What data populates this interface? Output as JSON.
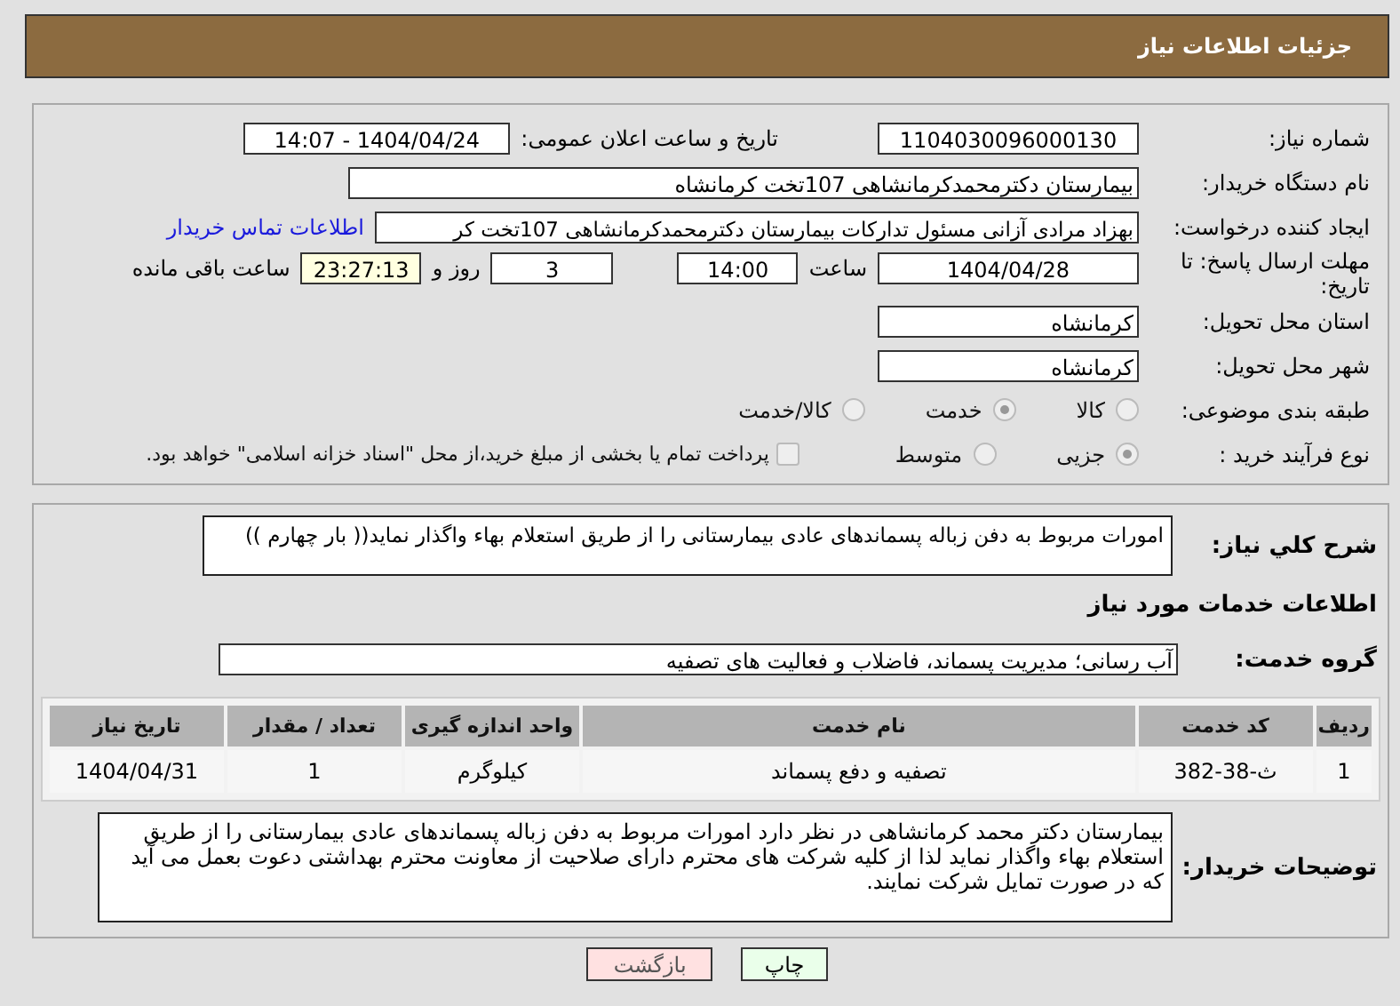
{
  "header": {
    "title": "جزئیات اطلاعات نیاز"
  },
  "need_number": {
    "label": "شماره نیاز:",
    "value": "1104030096000130"
  },
  "announce_date": {
    "label": "تاریخ و ساعت اعلان عمومی:",
    "value": "1404/04/24 - 14:07"
  },
  "buyer_org": {
    "label": "نام دستگاه خریدار:",
    "value": "بیمارستان دکترمحمدکرمانشاهی 107تخت کرمانشاه"
  },
  "requester": {
    "label": "ایجاد کننده درخواست:",
    "value": "بهزاد مرادی آزانی مسئول تدارکات بیمارستان دکترمحمدکرمانشاهی 107تخت کر",
    "link": "اطلاعات تماس خریدار"
  },
  "deadline": {
    "label": "مهلت ارسال پاسخ: تا تاریخ:",
    "date": "1404/04/28",
    "time_label": "ساعت",
    "time": "14:00",
    "days": "3",
    "days_label": "روز و",
    "remaining": "23:27:13",
    "remaining_label": "ساعت باقی مانده"
  },
  "province": {
    "label": "استان محل تحویل:",
    "value": "کرمانشاه"
  },
  "city": {
    "label": "شهر محل تحویل:",
    "value": "کرمانشاه"
  },
  "category": {
    "label": "طبقه بندی موضوعی:",
    "options": [
      {
        "label": "کالا",
        "selected": false
      },
      {
        "label": "خدمت",
        "selected": true
      },
      {
        "label": "کالا/خدمت",
        "selected": false
      }
    ]
  },
  "purchase_process": {
    "label": "نوع فرآیند خرید :",
    "options": [
      {
        "label": "جزیی",
        "selected": true
      },
      {
        "label": "متوسط",
        "selected": false
      }
    ],
    "payment": {
      "checked": false,
      "text": "پرداخت تمام یا بخشی از مبلغ خرید،از محل \"اسناد خزانه اسلامی\" خواهد بود."
    }
  },
  "description": {
    "label": "شرح کلي نياز:",
    "value": "امورات مربوط به دفن زباله پسماندهای عادی بیمارستانی را از طریق استعلام بهاء واگذار نماید(( بار چهارم ))"
  },
  "services_title": "اطلاعات خدمات مورد نیاز",
  "service_group": {
    "label": "گروه خدمت:",
    "value": "آب رسانی؛ مدیریت پسماند، فاضلاب و فعالیت های تصفیه"
  },
  "table": {
    "columns": [
      "ردیف",
      "کد خدمت",
      "نام خدمت",
      "واحد اندازه گیری",
      "تعداد / مقدار",
      "تاریخ نیاز"
    ],
    "rows": [
      [
        "1",
        "ث-38-382",
        "تصفیه و دفع پسماند",
        "کیلوگرم",
        "1",
        "1404/04/31"
      ]
    ]
  },
  "buyer_notes": {
    "label": "توضیحات خریدار:",
    "value": "بیمارستان دکتر محمد کرمانشاهی در نظر دارد امورات مربوط به دفن زباله پسماندهای عادی بیمارستانی را از طریق استعلام بهاء واگذار نماید لذا از کلیه شرکت های محترم دارای صلاحیت از معاونت محترم بهداشتی دعوت بعمل می آید که در صورت تمایل شرکت نمایند."
  },
  "buttons": [
    {
      "kind": "print",
      "label": "چاپ"
    },
    {
      "kind": "back",
      "label": "بازگشت"
    }
  ]
}
